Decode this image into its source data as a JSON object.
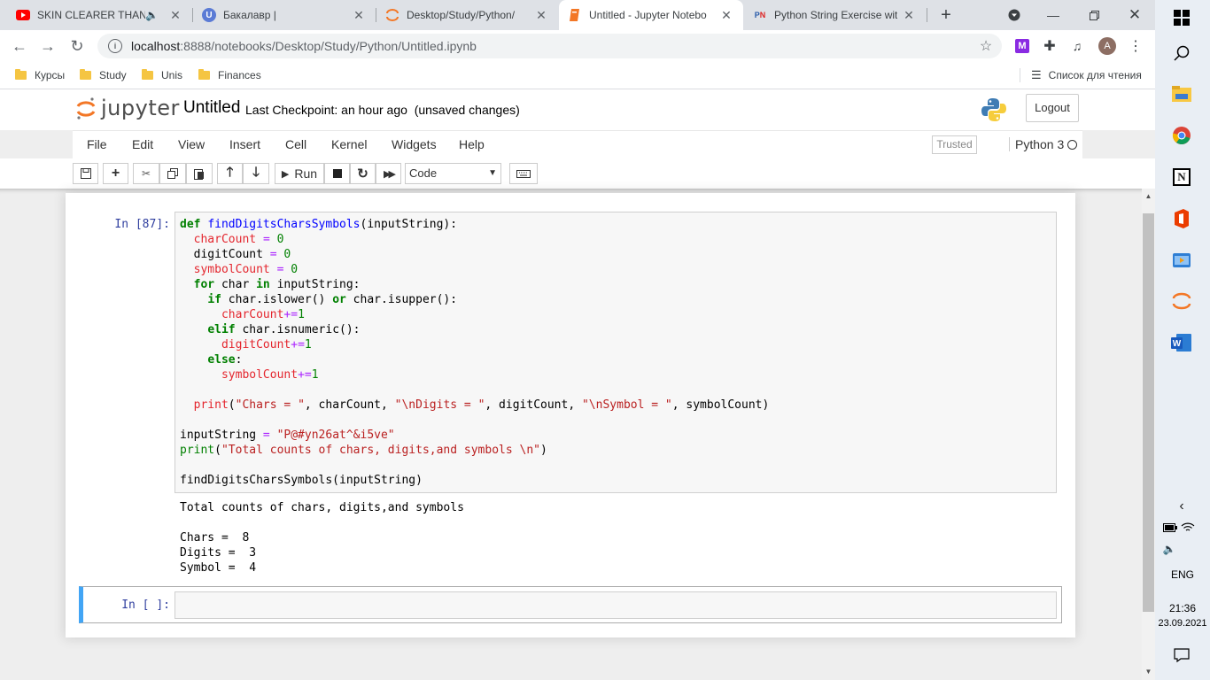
{
  "browser": {
    "tabs": [
      {
        "title": "SKIN CLEARER THAN C",
        "favicon": "youtube-icon"
      },
      {
        "title": "Бакалавр |",
        "favicon": "u-icon"
      },
      {
        "title": "Desktop/Study/Python/",
        "favicon": "jupyter-icon"
      },
      {
        "title": "Untitled - Jupyter Notebo",
        "favicon": "notebook-icon"
      },
      {
        "title": "Python String Exercise with",
        "favicon": "pynative-icon"
      }
    ],
    "url_host": "localhost",
    "url_rest": ":8888/notebooks/Desktop/Study/Python/Untitled.ipynb",
    "profile_initial": "A",
    "bookmarks": [
      "Курсы",
      "Study",
      "Unis",
      "Finances"
    ],
    "reading_list": "Список для чтения"
  },
  "jupyter": {
    "logo_text": "jupyter",
    "notebook_name": "Untitled",
    "checkpoint": "Last Checkpoint: an hour ago",
    "unsaved": "(unsaved changes)",
    "logout": "Logout",
    "menu": [
      "File",
      "Edit",
      "View",
      "Insert",
      "Cell",
      "Kernel",
      "Widgets",
      "Help"
    ],
    "trusted": "Trusted",
    "kernel": "Python 3",
    "run_label": "Run",
    "cell_type": "Code",
    "cell1_prompt": "In [87]:",
    "output_lines": [
      "Total counts of chars, digits,and symbols",
      "",
      "Chars =  8",
      "Digits =  3",
      "Symbol =  4"
    ],
    "cell2_prompt": "In [ ]:"
  },
  "taskbar": {
    "lang": "ENG",
    "time": "21:36",
    "date": "23.09.2021"
  }
}
